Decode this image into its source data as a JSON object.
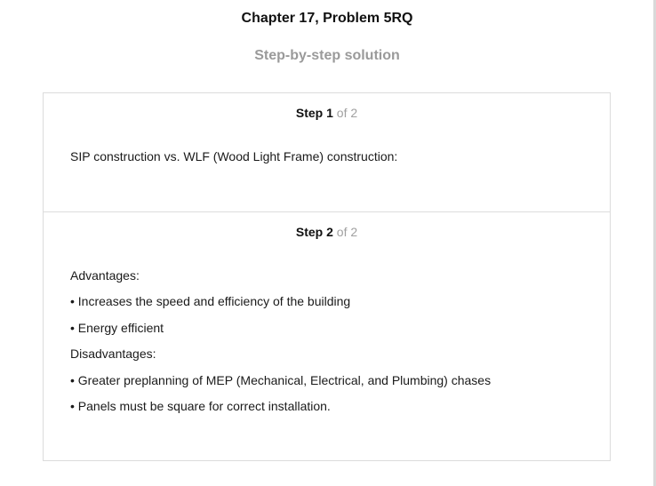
{
  "header": {
    "title": "Chapter 17, Problem 5RQ",
    "subtitle": "Step-by-step solution"
  },
  "steps": [
    {
      "word": "Step",
      "number": "1",
      "of": "of 2",
      "lines": [
        "SIP construction vs. WLF (Wood Light Frame) construction:"
      ]
    },
    {
      "word": "Step",
      "number": "2",
      "of": "of 2",
      "lines": [
        "Advantages:",
        "• Increases the speed and efficiency of the building",
        "• Energy efficient",
        "Disadvantages:",
        "• Greater preplanning of MEP (Mechanical, Electrical, and Plumbing) chases",
        "• Panels must be square for correct installation."
      ]
    }
  ]
}
